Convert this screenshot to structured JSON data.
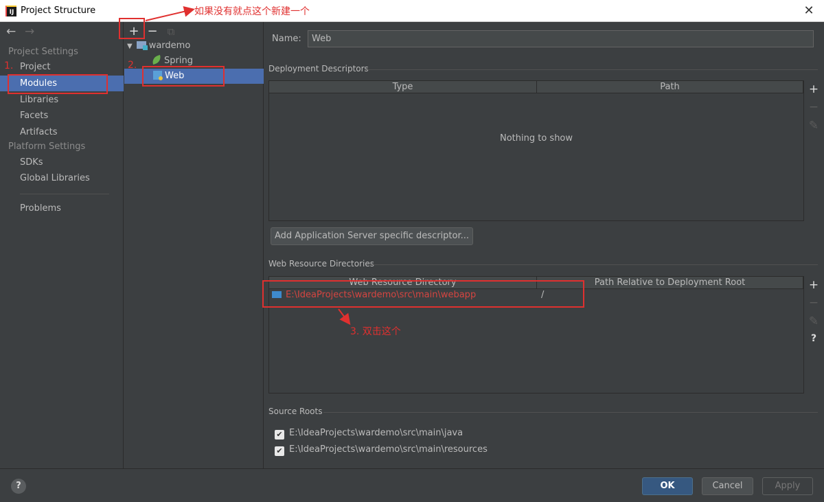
{
  "window": {
    "title": "Project Structure",
    "app_icon_text": "IJ",
    "close_glyph": "✕"
  },
  "nav": {
    "back_glyph": "←",
    "forward_glyph": "→",
    "project_settings_header": "Project Settings",
    "platform_settings_header": "Platform Settings",
    "items": {
      "project": "Project",
      "modules": "Modules",
      "libraries": "Libraries",
      "facets": "Facets",
      "artifacts": "Artifacts",
      "sdks": "SDKs",
      "global_libraries": "Global Libraries",
      "problems": "Problems"
    },
    "selected": "Modules"
  },
  "module_tree": {
    "toolbar": {
      "add_glyph": "+",
      "remove_glyph": "−",
      "copy_glyph": "⧉"
    },
    "expand_glyph": "▼",
    "root": "wardemo",
    "children": [
      "Spring",
      "Web"
    ],
    "selected": "Web"
  },
  "facet": {
    "name_label": "Name:",
    "name_value": "Web",
    "deployment_descriptors": {
      "title": "Deployment Descriptors",
      "columns": [
        "Type",
        "Path"
      ],
      "empty_text": "Nothing to show",
      "tools": {
        "add": "+",
        "remove": "−",
        "edit": "✎"
      }
    },
    "add_server_descriptor_label": "Add Application Server specific descriptor...",
    "web_resource_directories": {
      "title": "Web Resource Directories",
      "columns": [
        "Web Resource Directory",
        "Path Relative to Deployment Root"
      ],
      "rows": [
        {
          "directory": "E:\\IdeaProjects\\wardemo\\src\\main\\webapp",
          "relative_path": "/"
        }
      ],
      "tools": {
        "add": "+",
        "remove": "−",
        "edit": "✎",
        "help": "?"
      }
    },
    "source_roots": {
      "title": "Source Roots",
      "items": [
        {
          "path": "E:\\IdeaProjects\\wardemo\\src\\main\\java",
          "checked": true
        },
        {
          "path": "E:\\IdeaProjects\\wardemo\\src\\main\\resources",
          "checked": true
        }
      ],
      "check_glyph": "✔"
    }
  },
  "footer": {
    "help_glyph": "?",
    "ok": "OK",
    "cancel": "Cancel",
    "apply": "Apply"
  },
  "annotations": {
    "note_1": "1.",
    "note_2": "2.",
    "note_add": "如果没有就点这个新建一个",
    "note_3": "3. 双击这个",
    "color": "#e0302f"
  },
  "colors": {
    "background": "#3c3f41",
    "selection": "#4b6eaf",
    "primary_button": "#365880",
    "path_red": "#d64541"
  }
}
